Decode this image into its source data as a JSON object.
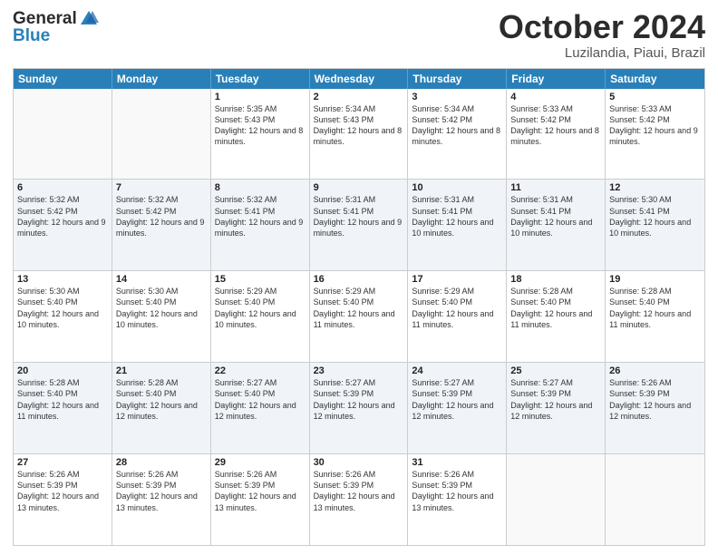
{
  "logo": {
    "line1": "General",
    "line2": "Blue"
  },
  "title": "October 2024",
  "location": "Luzilandia, Piaui, Brazil",
  "header_days": [
    "Sunday",
    "Monday",
    "Tuesday",
    "Wednesday",
    "Thursday",
    "Friday",
    "Saturday"
  ],
  "weeks": [
    [
      {
        "day": "",
        "text": ""
      },
      {
        "day": "",
        "text": ""
      },
      {
        "day": "1",
        "text": "Sunrise: 5:35 AM\nSunset: 5:43 PM\nDaylight: 12 hours and 8 minutes."
      },
      {
        "day": "2",
        "text": "Sunrise: 5:34 AM\nSunset: 5:43 PM\nDaylight: 12 hours and 8 minutes."
      },
      {
        "day": "3",
        "text": "Sunrise: 5:34 AM\nSunset: 5:42 PM\nDaylight: 12 hours and 8 minutes."
      },
      {
        "day": "4",
        "text": "Sunrise: 5:33 AM\nSunset: 5:42 PM\nDaylight: 12 hours and 8 minutes."
      },
      {
        "day": "5",
        "text": "Sunrise: 5:33 AM\nSunset: 5:42 PM\nDaylight: 12 hours and 9 minutes."
      }
    ],
    [
      {
        "day": "6",
        "text": "Sunrise: 5:32 AM\nSunset: 5:42 PM\nDaylight: 12 hours and 9 minutes."
      },
      {
        "day": "7",
        "text": "Sunrise: 5:32 AM\nSunset: 5:42 PM\nDaylight: 12 hours and 9 minutes."
      },
      {
        "day": "8",
        "text": "Sunrise: 5:32 AM\nSunset: 5:41 PM\nDaylight: 12 hours and 9 minutes."
      },
      {
        "day": "9",
        "text": "Sunrise: 5:31 AM\nSunset: 5:41 PM\nDaylight: 12 hours and 9 minutes."
      },
      {
        "day": "10",
        "text": "Sunrise: 5:31 AM\nSunset: 5:41 PM\nDaylight: 12 hours and 10 minutes."
      },
      {
        "day": "11",
        "text": "Sunrise: 5:31 AM\nSunset: 5:41 PM\nDaylight: 12 hours and 10 minutes."
      },
      {
        "day": "12",
        "text": "Sunrise: 5:30 AM\nSunset: 5:41 PM\nDaylight: 12 hours and 10 minutes."
      }
    ],
    [
      {
        "day": "13",
        "text": "Sunrise: 5:30 AM\nSunset: 5:40 PM\nDaylight: 12 hours and 10 minutes."
      },
      {
        "day": "14",
        "text": "Sunrise: 5:30 AM\nSunset: 5:40 PM\nDaylight: 12 hours and 10 minutes."
      },
      {
        "day": "15",
        "text": "Sunrise: 5:29 AM\nSunset: 5:40 PM\nDaylight: 12 hours and 10 minutes."
      },
      {
        "day": "16",
        "text": "Sunrise: 5:29 AM\nSunset: 5:40 PM\nDaylight: 12 hours and 11 minutes."
      },
      {
        "day": "17",
        "text": "Sunrise: 5:29 AM\nSunset: 5:40 PM\nDaylight: 12 hours and 11 minutes."
      },
      {
        "day": "18",
        "text": "Sunrise: 5:28 AM\nSunset: 5:40 PM\nDaylight: 12 hours and 11 minutes."
      },
      {
        "day": "19",
        "text": "Sunrise: 5:28 AM\nSunset: 5:40 PM\nDaylight: 12 hours and 11 minutes."
      }
    ],
    [
      {
        "day": "20",
        "text": "Sunrise: 5:28 AM\nSunset: 5:40 PM\nDaylight: 12 hours and 11 minutes."
      },
      {
        "day": "21",
        "text": "Sunrise: 5:28 AM\nSunset: 5:40 PM\nDaylight: 12 hours and 12 minutes."
      },
      {
        "day": "22",
        "text": "Sunrise: 5:27 AM\nSunset: 5:40 PM\nDaylight: 12 hours and 12 minutes."
      },
      {
        "day": "23",
        "text": "Sunrise: 5:27 AM\nSunset: 5:39 PM\nDaylight: 12 hours and 12 minutes."
      },
      {
        "day": "24",
        "text": "Sunrise: 5:27 AM\nSunset: 5:39 PM\nDaylight: 12 hours and 12 minutes."
      },
      {
        "day": "25",
        "text": "Sunrise: 5:27 AM\nSunset: 5:39 PM\nDaylight: 12 hours and 12 minutes."
      },
      {
        "day": "26",
        "text": "Sunrise: 5:26 AM\nSunset: 5:39 PM\nDaylight: 12 hours and 12 minutes."
      }
    ],
    [
      {
        "day": "27",
        "text": "Sunrise: 5:26 AM\nSunset: 5:39 PM\nDaylight: 12 hours and 13 minutes."
      },
      {
        "day": "28",
        "text": "Sunrise: 5:26 AM\nSunset: 5:39 PM\nDaylight: 12 hours and 13 minutes."
      },
      {
        "day": "29",
        "text": "Sunrise: 5:26 AM\nSunset: 5:39 PM\nDaylight: 12 hours and 13 minutes."
      },
      {
        "day": "30",
        "text": "Sunrise: 5:26 AM\nSunset: 5:39 PM\nDaylight: 12 hours and 13 minutes."
      },
      {
        "day": "31",
        "text": "Sunrise: 5:26 AM\nSunset: 5:39 PM\nDaylight: 12 hours and 13 minutes."
      },
      {
        "day": "",
        "text": ""
      },
      {
        "day": "",
        "text": ""
      }
    ]
  ]
}
